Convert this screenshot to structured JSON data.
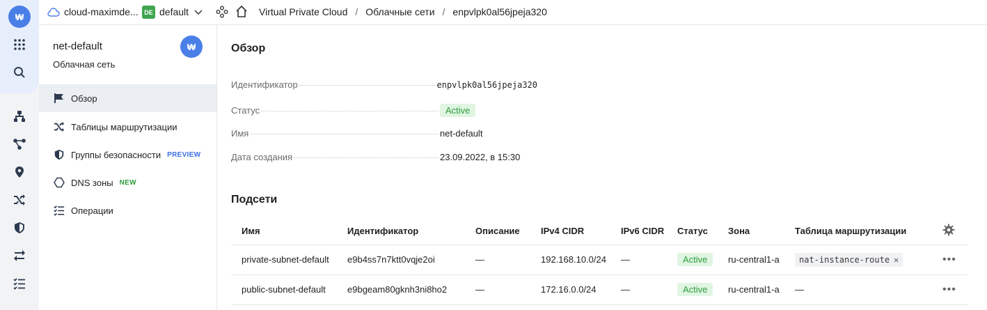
{
  "topbar": {
    "cloud_name": "cloud-maximde...",
    "folder_badge": "DE",
    "folder_name": "default",
    "breadcrumbs": [
      "Virtual Private Cloud",
      "Облачные сети",
      "enpvlpk0al56jpeja320"
    ],
    "separator": "/"
  },
  "rail": {
    "logo_letter": "₩"
  },
  "sidemenu": {
    "title": "net-default",
    "subtitle": "Облачная сеть",
    "avatar_letter": "₩",
    "items": [
      {
        "label": "Обзор",
        "icon": "flag-icon",
        "active": true,
        "tag": ""
      },
      {
        "label": "Таблицы маршрутизации",
        "icon": "shuffle-icon",
        "active": false,
        "tag": ""
      },
      {
        "label": "Группы безопасности",
        "icon": "shield-icon",
        "active": false,
        "tag": "PREVIEW"
      },
      {
        "label": "DNS зоны",
        "icon": "hexagon-icon",
        "active": false,
        "tag": "NEW"
      },
      {
        "label": "Операции",
        "icon": "list-check-icon",
        "active": false,
        "tag": ""
      }
    ]
  },
  "overview": {
    "title": "Обзор",
    "fields": [
      {
        "key": "Идентификатор",
        "value": "enpvlpk0al56jpeja320"
      },
      {
        "key": "Статус",
        "value": "Active"
      },
      {
        "key": "Имя",
        "value": "net-default"
      },
      {
        "key": "Дата создания",
        "value": "23.09.2022, в 15:30"
      }
    ]
  },
  "subnets": {
    "title": "Подсети",
    "columns": [
      "Имя",
      "Идентификатор",
      "Описание",
      "IPv4 CIDR",
      "IPv6 CIDR",
      "Статус",
      "Зона",
      "Таблица маршрутизации"
    ],
    "rows": [
      {
        "name": "private-subnet-default",
        "id": "e9b4ss7n7ktt0vqje2oi",
        "description": "—",
        "ipv4": "192.168.10.0/24",
        "ipv6": "—",
        "status": "Active",
        "zone": "ru-central1-a",
        "route_table": "nat-instance-route",
        "more": "•••"
      },
      {
        "name": "public-subnet-default",
        "id": "e9bgeam80gknh3ni8ho2",
        "description": "—",
        "ipv4": "172.16.0.0/24",
        "ipv6": "—",
        "status": "Active",
        "zone": "ru-central1-a",
        "route_table": "—",
        "more": "•••"
      }
    ]
  },
  "colors": {
    "accent": "#4a7fe8",
    "active_bg": "#e0f5e2",
    "active_fg": "#2f9d3f",
    "menu_selected": "#ebeef3"
  }
}
